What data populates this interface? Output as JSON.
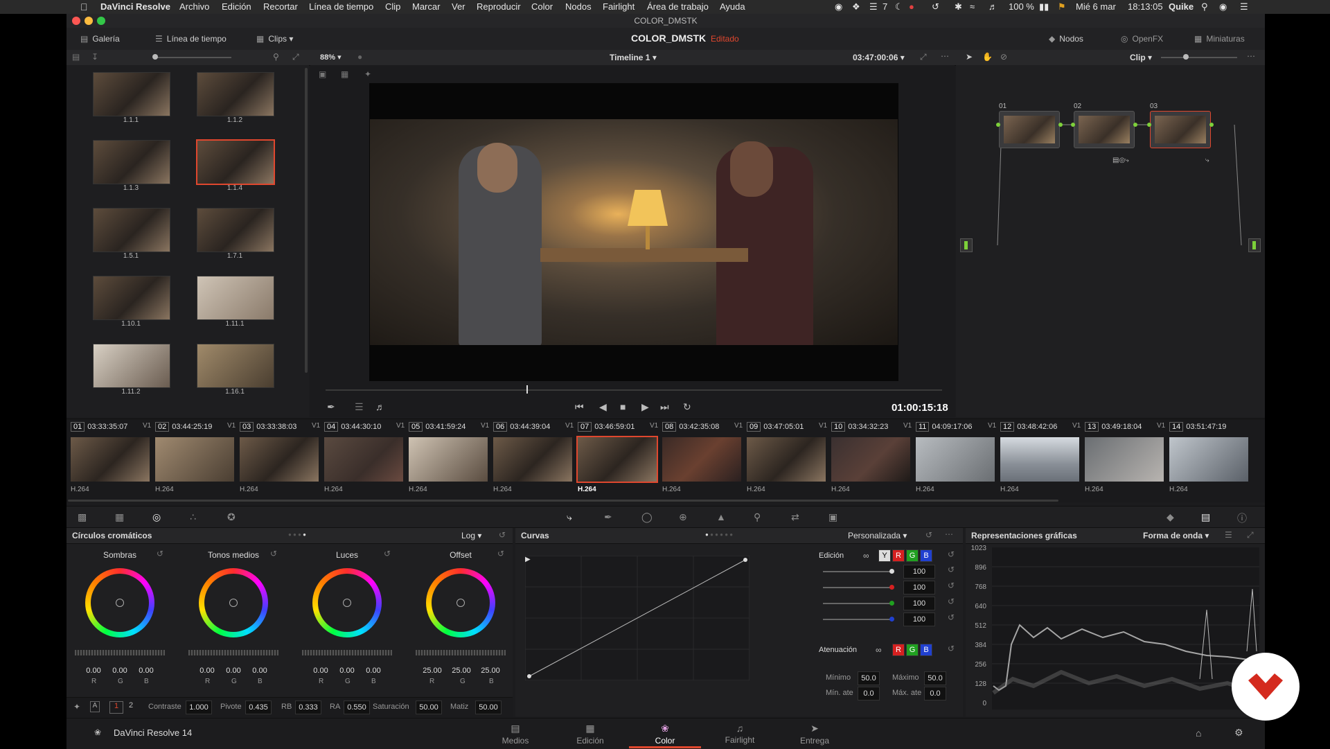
{
  "menubar": {
    "apple": "",
    "items": [
      "DaVinci Resolve",
      "Archivo",
      "Edición",
      "Recortar",
      "Línea de tiempo",
      "Clip",
      "Marcar",
      "Ver",
      "Reproducir",
      "Color",
      "Nodos",
      "Fairlight",
      "Área de trabajo",
      "Ayuda"
    ],
    "right": {
      "battery": "100 %",
      "date": "Mié 6 mar",
      "time": "18:13:05",
      "user": "Quike",
      "badge": "7"
    }
  },
  "window": {
    "title": "COLOR_DMSTK"
  },
  "topbar": {
    "gallery": "Galería",
    "timeline": "Línea de tiempo",
    "clips": "Clips",
    "project": "COLOR_DMSTK",
    "status": "Editado",
    "nodes": "Nodos",
    "openfx": "OpenFX",
    "thumbnails": "Miniaturas"
  },
  "subbar": {
    "zoom": "88%",
    "timeline_name": "Timeline 1",
    "timecode": "03:47:00:06",
    "clip_mode": "Clip"
  },
  "gallery": {
    "stills": [
      "1.1.1",
      "1.1.2",
      "1.1.3",
      "1.1.4",
      "1.5.1",
      "1.7.1",
      "1.10.1",
      "1.11.1",
      "1.11.2",
      "1.16.1"
    ],
    "selected": "1.1.4"
  },
  "viewer": {
    "timecode": "01:00:15:18"
  },
  "nodes": {
    "labels": [
      "01",
      "02",
      "03"
    ],
    "selected": "03"
  },
  "clips": [
    {
      "n": "01",
      "tc": "03:33:35:07",
      "v": "V1",
      "fmt": "H.264"
    },
    {
      "n": "02",
      "tc": "03:44:25:19",
      "v": "V1",
      "fmt": "H.264"
    },
    {
      "n": "03",
      "tc": "03:33:38:03",
      "v": "V1",
      "fmt": "H.264"
    },
    {
      "n": "04",
      "tc": "03:44:30:10",
      "v": "V1",
      "fmt": "H.264"
    },
    {
      "n": "05",
      "tc": "03:41:59:24",
      "v": "V1",
      "fmt": "H.264"
    },
    {
      "n": "06",
      "tc": "03:44:39:04",
      "v": "V1",
      "fmt": "H.264"
    },
    {
      "n": "07",
      "tc": "03:46:59:01",
      "v": "V1",
      "fmt": "H.264"
    },
    {
      "n": "08",
      "tc": "03:42:35:08",
      "v": "V1",
      "fmt": "H.264"
    },
    {
      "n": "09",
      "tc": "03:47:05:01",
      "v": "V1",
      "fmt": "H.264"
    },
    {
      "n": "10",
      "tc": "03:34:32:23",
      "v": "V1",
      "fmt": "H.264"
    },
    {
      "n": "11",
      "tc": "04:09:17:06",
      "v": "V1",
      "fmt": "H.264"
    },
    {
      "n": "12",
      "tc": "03:48:42:06",
      "v": "V1",
      "fmt": "H.264"
    },
    {
      "n": "13",
      "tc": "03:49:18:04",
      "v": "V1",
      "fmt": "H.264"
    },
    {
      "n": "14",
      "tc": "03:51:47:19",
      "v": "",
      "fmt": "H.264"
    }
  ],
  "active_clip": "07",
  "wheels": {
    "title": "Círculos cromáticos",
    "mode": "Log",
    "items": [
      {
        "label": "Sombras",
        "r": "0.00",
        "g": "0.00",
        "b": "0.00"
      },
      {
        "label": "Tonos medios",
        "r": "0.00",
        "g": "0.00",
        "b": "0.00"
      },
      {
        "label": "Luces",
        "r": "0.00",
        "g": "0.00",
        "b": "0.00"
      },
      {
        "label": "Offset",
        "r": "25.00",
        "g": "25.00",
        "b": "25.00"
      }
    ],
    "rgb_labels": [
      "R",
      "G",
      "B"
    ],
    "footer": {
      "page1": "1",
      "page2": "2",
      "contrast_l": "Contraste",
      "contrast": "1.000",
      "pivot_l": "Pivote",
      "pivot": "0.435",
      "rb_l": "RB",
      "rb": "0.333",
      "ra_l": "RA",
      "ra": "0.550",
      "sat_l": "Saturación",
      "sat": "50.00",
      "hue_l": "Matiz",
      "hue": "50.00"
    }
  },
  "curves": {
    "title": "Curvas",
    "mode": "Personalizada",
    "edit_label": "Edición",
    "channels": [
      "Y",
      "R",
      "G",
      "B"
    ],
    "intensities": [
      "100",
      "100",
      "100",
      "100"
    ],
    "atten_label": "Atenuación",
    "atten_channels": [
      "R",
      "G",
      "B"
    ],
    "min_l": "Mínimo",
    "min": "50.0",
    "max_l": "Máximo",
    "max": "50.0",
    "minatt_l": "Mín. ate",
    "minatt": "0.0",
    "maxatt_l": "Máx. ate",
    "maxatt": "0.0"
  },
  "scopes": {
    "title": "Representaciones gráficas",
    "mode": "Forma de onda",
    "ticks": [
      "1023",
      "896",
      "768",
      "640",
      "512",
      "384",
      "256",
      "128",
      "0"
    ]
  },
  "pages": {
    "brand": "DaVinci Resolve 14",
    "items": [
      "Medios",
      "Edición",
      "Color",
      "Fairlight",
      "Entrega"
    ],
    "active": "Color"
  },
  "colors": {
    "accent": "#e0472e",
    "node_green": "#7dd13a"
  }
}
